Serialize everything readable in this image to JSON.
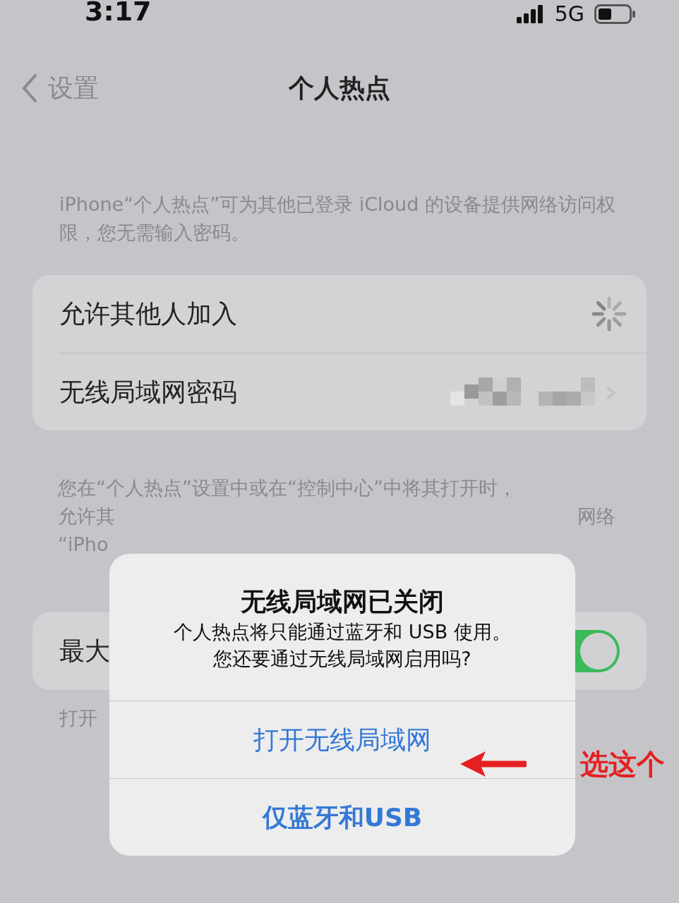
{
  "status_bar": {
    "time": "3:17",
    "network": "5G"
  },
  "nav": {
    "back": "设置",
    "title": "个人热点"
  },
  "intro": "iPhone“个人热点”可为其他已登录 iCloud 的设备提供网络访问权限，您无需输入密码。",
  "settings": [
    {
      "label": "允许其他人加入",
      "kind": "spinner"
    },
    {
      "label": "无线局域网密码",
      "kind": "hidden_value"
    }
  ],
  "footer_note": {
    "line_1": "您在“个人热点”设置中或在“控制中心”中将其打开时，",
    "line_2_left": "允许其",
    "line_2_right": "网络",
    "line_3": "“iPho"
  },
  "compat_row": {
    "label": "最大",
    "on": true
  },
  "compat_note": "打开",
  "alert": {
    "title": "无线局域网已关闭",
    "message": [
      "个人热点将只能通过蓝牙和 USB 使用。",
      "您还要通过无线局域网启用吗?"
    ],
    "actions": [
      {
        "label": "打开无线局域网",
        "preferred": false
      },
      {
        "label": "仅蓝牙和USB",
        "preferred": true
      }
    ]
  },
  "annotation": {
    "text": "选这个"
  }
}
